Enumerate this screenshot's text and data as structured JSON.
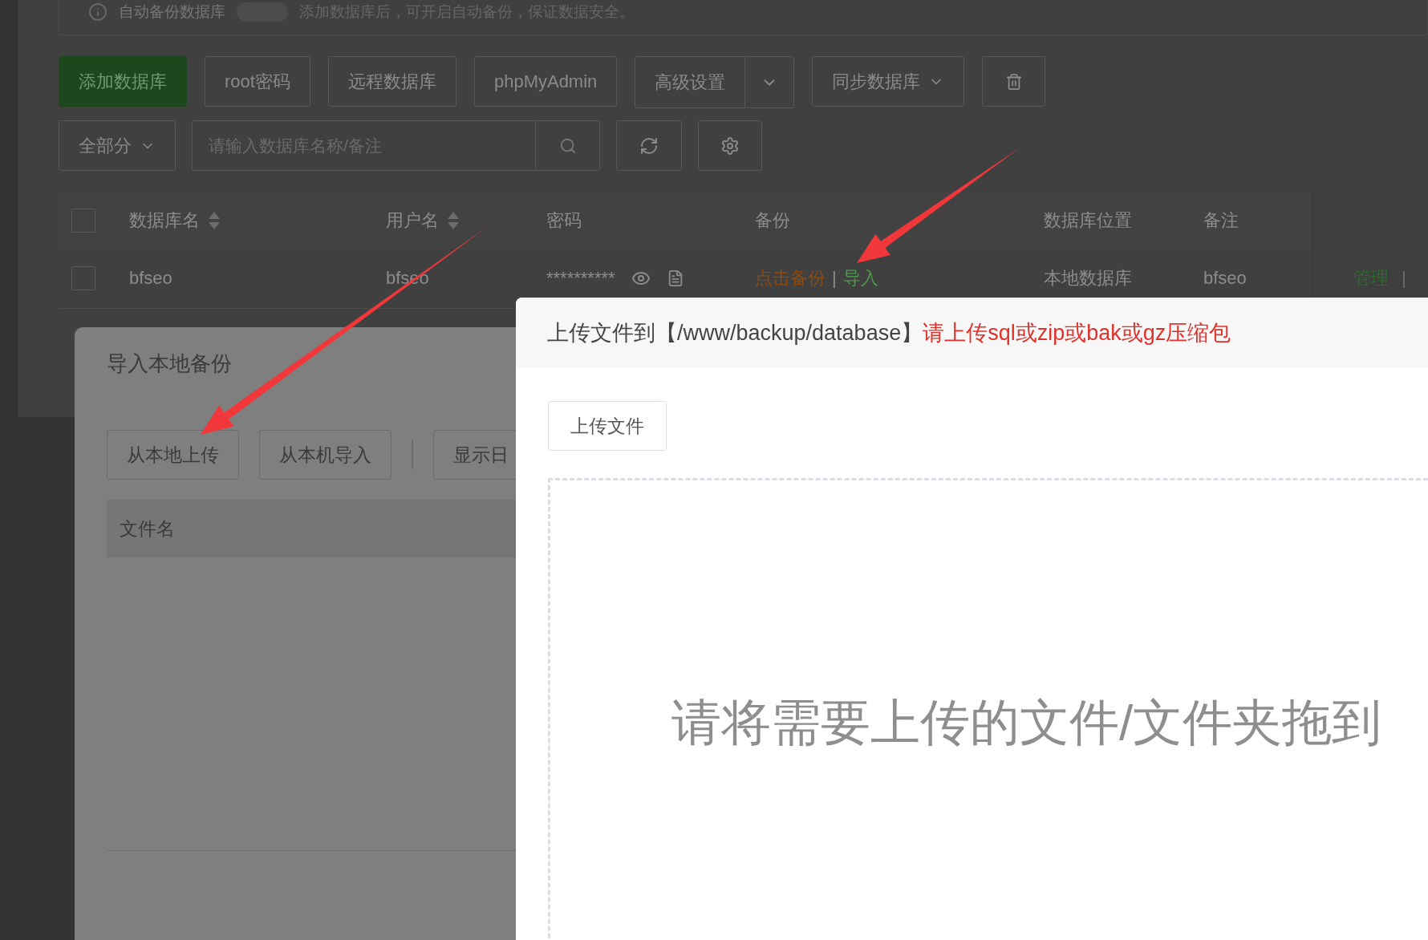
{
  "auto_backup": {
    "label": "自动备份数据库",
    "on": false,
    "hint": "添加数据库后，可开启自动备份，保证数据安全。"
  },
  "toolbar": [
    {
      "kind": "primary",
      "label": "添加数据库"
    },
    {
      "kind": "plain",
      "label": "root密码"
    },
    {
      "kind": "plain",
      "label": "远程数据库"
    },
    {
      "kind": "plain",
      "label": "phpMyAdmin"
    },
    {
      "kind": "split",
      "label": "高级设置"
    },
    {
      "kind": "dropdown",
      "label": "同步数据库"
    },
    {
      "kind": "trash"
    }
  ],
  "filter": {
    "label": "全部分",
    "search_placeholder": "请输入数据库名称/备注"
  },
  "table": {
    "all_checked": false,
    "columns": [
      {
        "label": "数据库名",
        "sortable": true
      },
      {
        "label": "用户名",
        "sortable": true
      },
      {
        "label": "密码",
        "sortable": false
      },
      {
        "label": "备份",
        "sortable": false
      },
      {
        "label": "数据库位置",
        "sortable": false
      },
      {
        "label": "备注",
        "sortable": false
      }
    ],
    "rows": [
      {
        "checked": false,
        "name": "bfseo",
        "user": "bfseo",
        "password": "**********",
        "backup": "点击备份",
        "separator": "|",
        "import": "导入",
        "location": "本地数据库",
        "note": "bfseo",
        "actions": [
          "管理",
          "|"
        ]
      }
    ]
  },
  "import_dialog": {
    "title": "导入本地备份",
    "buttons": [
      "从本地上传",
      "从本机导入",
      "显示日"
    ],
    "columns": [
      "文件名"
    ]
  },
  "upload_dialog": {
    "title": "上传文件到【/www/backup/database】",
    "hint": "请上传sql或zip或bak或gz压缩包",
    "button": "上传文件",
    "drop_text": "请将需要上传的文件/文件夹拖到"
  }
}
